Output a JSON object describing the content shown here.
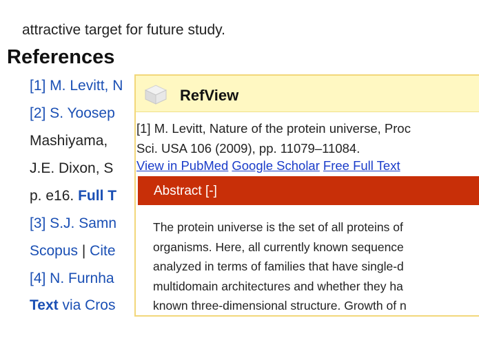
{
  "article": {
    "intro_text": "attractive target for future study.",
    "references_heading": "References",
    "ref1_num": "[1] M. Levitt, N",
    "ref2_num": "[2] S. Yoosep",
    "ref2_cont": "Mashiyama,",
    "ref2_cont2": "J.E. Dixon, S",
    "ref2_pages": "p. e16.",
    "ref2_full": "Full T",
    "ref3": "[3] S.J. Samn",
    "ref3_scopus": "Scopus",
    "ref3_sep": " | ",
    "ref3_cite": "Cite",
    "ref4": "[4] N. Furnha",
    "ref4_text": "Text",
    "ref4_via": " via Cros"
  },
  "refview": {
    "title": "RefView",
    "icon": "cube-icon",
    "citation_line1": "[1] M. Levitt, Nature of the protein universe, Proc",
    "citation_line2": "Sci. USA 106 (2009), pp. 11079–11084.",
    "links": {
      "pubmed": "View in PubMed",
      "scholar": "Google Scholar",
      "fulltext": "Free Full Text"
    },
    "abstract_label": "Abstract [-]",
    "abstract_lines": [
      "The protein universe is the set of all proteins of",
      "organisms. Here, all currently known sequence",
      "analyzed in terms of families that have single-d",
      "multidomain architectures and whether they ha",
      "known three-dimensional structure. Growth of n"
    ]
  },
  "colors": {
    "link_blue": "#1a4fb4",
    "popup_header_bg": "#fff8c2",
    "abstract_bar_bg": "#c82f08"
  }
}
